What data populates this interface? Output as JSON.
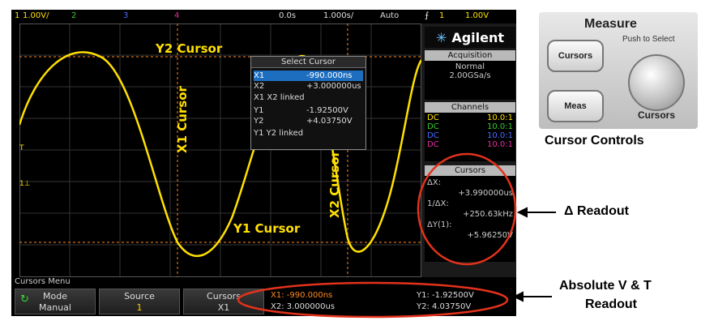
{
  "status": {
    "ch1": "1",
    "ch1_scale": "1.00V/",
    "ch2": "2",
    "ch3": "3",
    "ch4": "4",
    "time_pos": "0.0s",
    "time_scale": "1.000s/",
    "trigger_mode": "Auto",
    "trig_ch": "1",
    "trig_level": "1.00V"
  },
  "right_panel": {
    "brand": "Agilent",
    "acq_header": "Acquisition",
    "acq_mode": "Normal",
    "acq_rate": "2.00GSa/s",
    "channels_header": "Channels",
    "channels": [
      {
        "coupling": "DC",
        "probe": "10.0:1",
        "color": "#ffe000"
      },
      {
        "coupling": "DC",
        "probe": "10.0:1",
        "color": "#33cc33"
      },
      {
        "coupling": "DC",
        "probe": "10.0:1",
        "color": "#4a6cff"
      },
      {
        "coupling": "DC",
        "probe": "10.0:1",
        "color": "#e0309a"
      }
    ],
    "cursors_header": "Cursors",
    "dx_label": "ΔX:",
    "dx_value": "+3.990000us",
    "inv_dx_label": "1/ΔX:",
    "inv_dx_value": "+250.63kHz",
    "dy_label": "ΔY(1):",
    "dy_value": "+5.96250V"
  },
  "popup": {
    "title": "Select Cursor",
    "items": [
      {
        "label": "X1",
        "value": "-990.000ns"
      },
      {
        "label": "X2",
        "value": "+3.000000us"
      },
      {
        "label": "X1 X2 linked",
        "value": ""
      },
      {
        "label": "Y1",
        "value": "-1.92500V"
      },
      {
        "label": "Y2",
        "value": "+4.03750V"
      },
      {
        "label": "Y1 Y2 linked",
        "value": ""
      }
    ]
  },
  "annotations": {
    "y2": "Y2 Cursor",
    "y1": "Y1 Cursor",
    "x1": "X1 Cursor",
    "x2": "X2 Cursor"
  },
  "menu": {
    "title": "Cursors Menu",
    "mode_label": "Mode",
    "mode_value": "Manual",
    "source_label": "Source",
    "source_value": "1",
    "cursors_label": "Cursors",
    "cursors_value": "X1",
    "x1_readout": "X1: -990.000ns",
    "x2_readout": "X2: 3.000000us",
    "y1_readout": "Y1: -1.92500V",
    "y2_readout": "Y2: 4.03750V"
  },
  "photo": {
    "measure_title": "Measure",
    "push_to_select": "Push to Select",
    "cursors_btn": "Cursors",
    "meas_btn": "Meas",
    "knob_label": "Cursors"
  },
  "labels": {
    "cursor_controls": "Cursor Controls",
    "delta_readout": "Δ Readout",
    "abs_readout_1": "Absolute V & T",
    "abs_readout_2": "Readout"
  },
  "colors": {
    "ch1": "#ffe000",
    "cursor_line": "#ff8a1f",
    "highlight_ring": "#e3321c",
    "selection": "#1e6ec0"
  }
}
